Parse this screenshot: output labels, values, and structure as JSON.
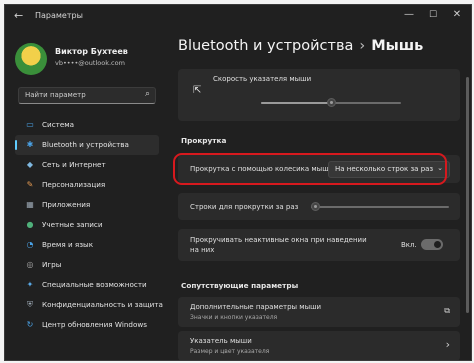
{
  "window": {
    "title": "Параметры",
    "back_glyph": "←",
    "controls": {
      "minimize": "—",
      "maximize": "☐",
      "close": "✕"
    }
  },
  "user": {
    "name": "Виктор Бухтеев",
    "email": "vb••••@outlook.com"
  },
  "search": {
    "placeholder": "Найти параметр",
    "icon": "search-icon"
  },
  "nav": [
    {
      "label": "Система",
      "icon": "display-icon",
      "glyph": "▭",
      "color": "#4aa3e8"
    },
    {
      "label": "Bluetooth и устройства",
      "icon": "bluetooth-icon",
      "glyph": "✱",
      "color": "#4aa3e8",
      "active": true
    },
    {
      "label": "Сеть и Интернет",
      "icon": "network-icon",
      "glyph": "◆",
      "color": "#7fb8e0"
    },
    {
      "label": "Персонализация",
      "icon": "brush-icon",
      "glyph": "✎",
      "color": "#e59a52"
    },
    {
      "label": "Приложения",
      "icon": "apps-icon",
      "glyph": "▦",
      "color": "#9aa6b2"
    },
    {
      "label": "Учетные записи",
      "icon": "person-icon",
      "glyph": "●",
      "color": "#4fb07a"
    },
    {
      "label": "Время и язык",
      "icon": "globe-icon",
      "glyph": "◔",
      "color": "#4aa3e8"
    },
    {
      "label": "Игры",
      "icon": "gamepad-icon",
      "glyph": "◎",
      "color": "#aaaaaa"
    },
    {
      "label": "Специальные возможности",
      "icon": "accessibility-icon",
      "glyph": "✦",
      "color": "#5aa9e6"
    },
    {
      "label": "Конфиденциальность и защита",
      "icon": "shield-icon",
      "glyph": "⛨",
      "color": "#9aa6b2"
    },
    {
      "label": "Центр обновления Windows",
      "icon": "update-icon",
      "glyph": "↻",
      "color": "#4aa3e8"
    }
  ],
  "main": {
    "breadcrumb_parent": "Bluetooth и устройства",
    "breadcrumb_sep": "›",
    "breadcrumb_current": "Мышь",
    "pointer_speed": {
      "label": "Скорость указателя мыши",
      "value": 0.5
    },
    "scroll_section": "Прокрутка",
    "wheel_scroll": {
      "label": "Прокрутка с помощью колесика мыши",
      "value": "На несколько строк за раз",
      "chevron": "⌄"
    },
    "lines_to_scroll": {
      "label": "Строки для прокрутки за раз",
      "value": 0.03
    },
    "inactive_scroll": {
      "label_line1": "Прокручивать неактивные окна при наведении",
      "label_line2": "на них",
      "state_label": "Вкл.",
      "on": true
    },
    "related_section": "Сопутствующие параметры",
    "related": [
      {
        "title": "Дополнительные параметры мыши",
        "subtitle": "Значки и кнопки указателя",
        "icon": "external-link-icon",
        "glyph": "⧉"
      },
      {
        "title": "Указатель мыши",
        "subtitle": "Размер и цвет указателя",
        "icon": "chevron-right-icon",
        "glyph": "›"
      }
    ]
  }
}
